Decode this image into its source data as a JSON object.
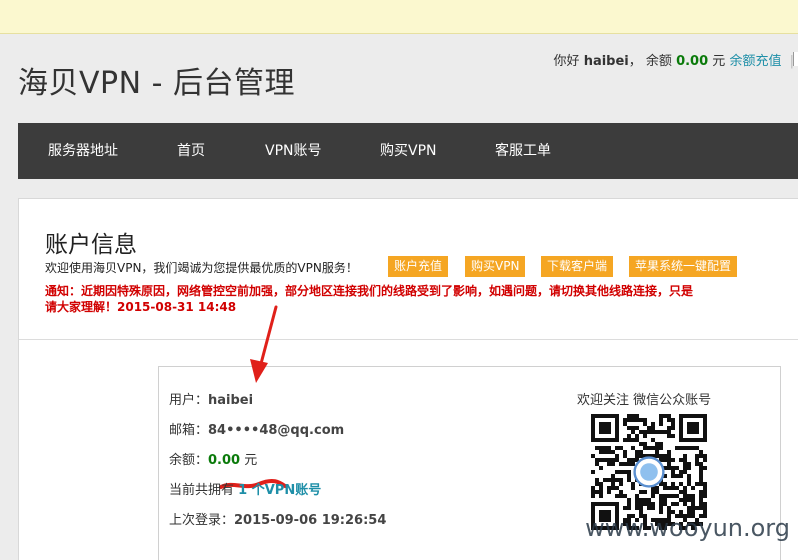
{
  "site": {
    "title": "海贝VPN - 后台管理"
  },
  "user_bar": {
    "greeting": "你好",
    "username": "haibei",
    "balance_label": "余额",
    "balance_value": "0.00",
    "currency": "元",
    "recharge_link": "余额充值",
    "separator": "|"
  },
  "nav": {
    "items": [
      "服务器地址",
      "首页",
      "VPN账号",
      "购买VPN",
      "客服工单"
    ]
  },
  "account": {
    "title": "账户信息",
    "welcome": "欢迎使用海贝VPN，我们竭诚为您提供最优质的VPN服务！",
    "buttons": [
      "账户充值",
      "购买VPN",
      "下载客户端",
      "苹果系统一键配置"
    ],
    "notice_line1": "通知：近期因特殊原因，网络管控空前加强，部分地区连接我们的线路受到了影响，如遇问题，请切换其他线路连接，只是",
    "notice_line2": "请大家理解！2015-08-31 14:48"
  },
  "info": {
    "user_label": "用户：",
    "user_value": "haibei",
    "email_label": "邮箱：",
    "email_value": "84••••48@qq.com",
    "balance_label": "余额：",
    "balance_value": "0.00",
    "balance_unit": "元",
    "owned_prefix": "当前共拥有",
    "owned_link": "1 个VPN账号",
    "last_login_label": "上次登录：",
    "last_login_value": "2015-09-06 19:26:54",
    "qr_label": "欢迎关注 微信公众账号"
  },
  "watermark": "www.wooyun.org",
  "colors": {
    "nav_bg": "#3c3c3c",
    "button_orange": "#f5a623",
    "notice_red": "#d10000",
    "money_green": "#0a7a0a",
    "link_teal": "#1e8fa8"
  }
}
